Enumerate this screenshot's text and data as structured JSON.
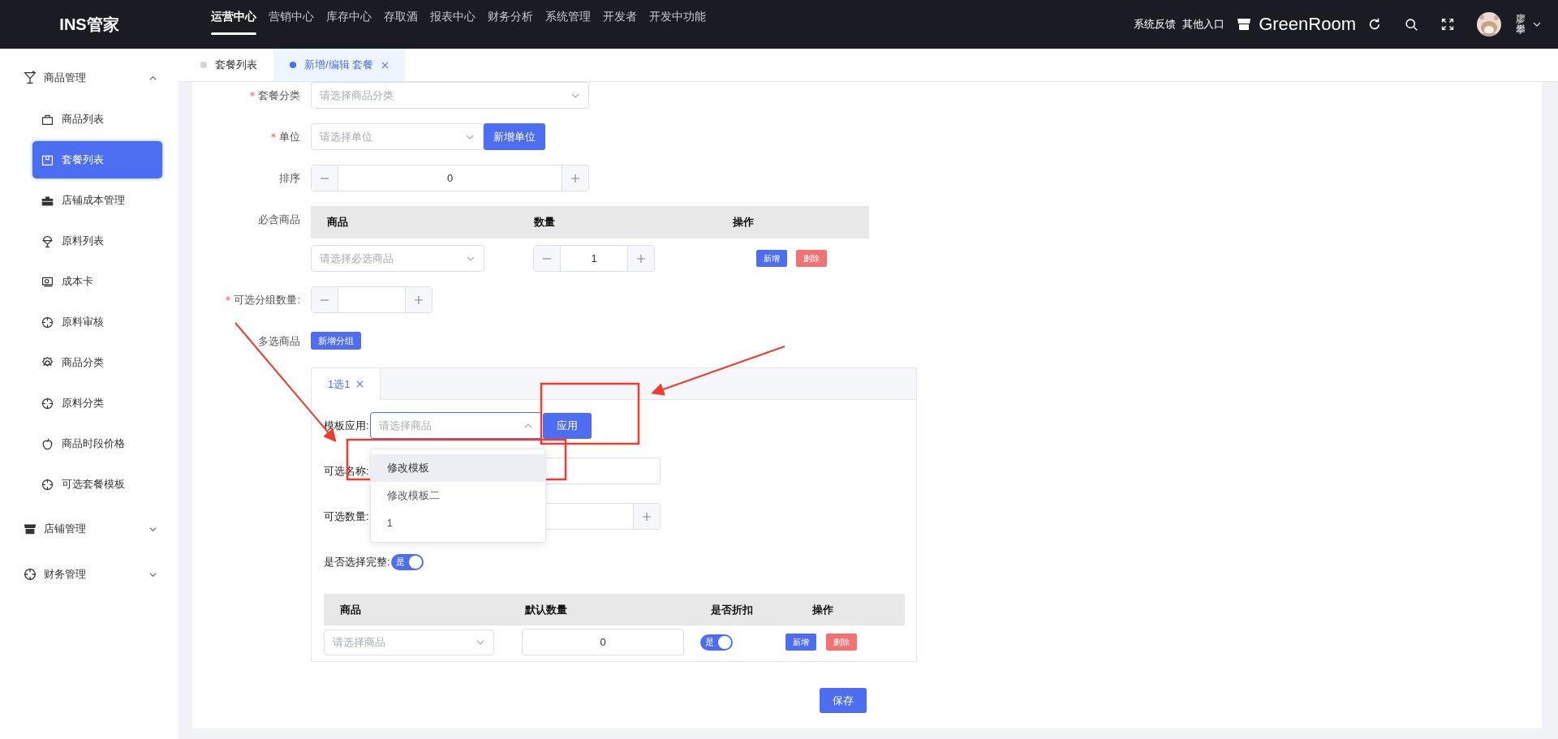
{
  "app": {
    "logo": "INS管家"
  },
  "top_nav": [
    {
      "label": "运营中心",
      "selected": true
    },
    {
      "label": "营销中心",
      "selected": false
    },
    {
      "label": "库存中心",
      "selected": false
    },
    {
      "label": "存取酒",
      "selected": false
    },
    {
      "label": "报表中心",
      "selected": false
    },
    {
      "label": "财务分析",
      "selected": false
    },
    {
      "label": "系统管理",
      "selected": false
    },
    {
      "label": "开发者",
      "selected": false
    },
    {
      "label": "开发中功能",
      "selected": false
    }
  ],
  "header_links": [
    "系统反馈",
    "其他入口"
  ],
  "store": {
    "name": "GreenRoom"
  },
  "user": {
    "name": "廖攀"
  },
  "sidebar": [
    {
      "label": "商品管理",
      "expanded": true,
      "children": [
        {
          "label": "商品列表",
          "selected": false
        },
        {
          "label": "套餐列表",
          "selected": true
        },
        {
          "label": "店铺成本管理",
          "selected": false
        },
        {
          "label": "原料列表",
          "selected": false
        },
        {
          "label": "成本卡",
          "selected": false
        },
        {
          "label": "原料审核",
          "selected": false
        },
        {
          "label": "商品分类",
          "selected": false
        },
        {
          "label": "原料分类",
          "selected": false
        },
        {
          "label": "商品时段价格",
          "selected": false
        },
        {
          "label": "可选套餐模板",
          "selected": false
        }
      ]
    },
    {
      "label": "店铺管理",
      "expanded": false
    },
    {
      "label": "财务管理",
      "expanded": false
    }
  ],
  "page_tabs": [
    {
      "label": "套餐列表",
      "selected": false,
      "closable": false
    },
    {
      "label": "新增/编辑 套餐",
      "selected": true,
      "closable": true
    }
  ],
  "form": {
    "fields": [
      {
        "kind": "select",
        "label": "套餐分类",
        "required": true,
        "placeholder": "请选择商品分类"
      },
      {
        "kind": "select",
        "label": "单位",
        "required": true,
        "placeholder": "请选择单位",
        "button": "新增单位"
      },
      {
        "kind": "number",
        "label": "排序",
        "required": false,
        "value": "0"
      },
      {
        "kind": "table",
        "label": "必含商品",
        "required": false,
        "columns": [
          "商品",
          "数量",
          "操作"
        ],
        "rows": [
          {
            "placeholder": "请选择必选商品",
            "quantity": "1",
            "actions": [
              "新增",
              "删除"
            ]
          }
        ]
      },
      {
        "kind": "number",
        "label": "可选分组数量:",
        "required": true
      },
      {
        "kind": "button",
        "label": "多选商品",
        "required": false,
        "button": "新增分组"
      }
    ],
    "group_panel": {
      "tabs": [
        {
          "label": "1选1",
          "selected": true
        }
      ],
      "template": {
        "label": "模板应用:",
        "placeholder": "请选择商品",
        "expanded": true,
        "button": "应用",
        "options": [
          {
            "label": "修改模板",
            "highlighted": true
          },
          {
            "label": "修改模板二",
            "highlighted": false
          },
          {
            "label": "1",
            "highlighted": false
          }
        ]
      },
      "name_label": "可选名称:",
      "count_label": "可选数量:",
      "complete": {
        "label": "是否选择完整:",
        "on": true,
        "text": "是"
      },
      "table": {
        "columns": [
          "商品",
          "默认数量",
          "是否折扣",
          "操作"
        ],
        "rows": [
          {
            "placeholder": "请选择商品",
            "quantity": "0",
            "discount": {
              "on": true,
              "text": "是"
            },
            "actions": [
              "新增",
              "删除"
            ]
          }
        ]
      }
    },
    "save_button": "保存"
  }
}
